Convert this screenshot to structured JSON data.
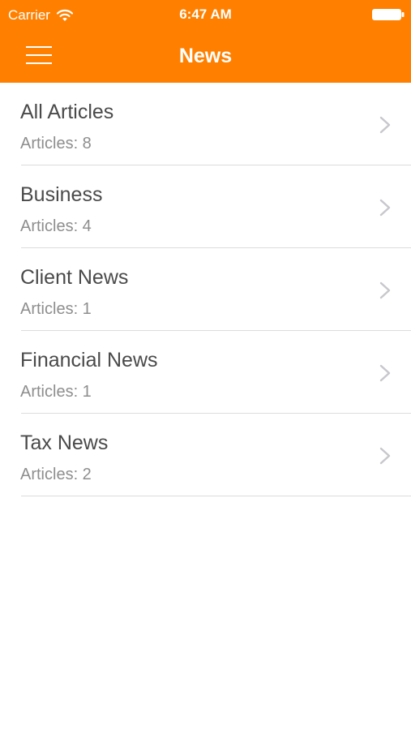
{
  "status_bar": {
    "carrier": "Carrier",
    "time": "6:47 AM",
    "wifi_icon": "wifi-icon",
    "battery_icon": "battery-full-icon"
  },
  "nav": {
    "title": "News",
    "menu_icon": "hamburger-menu-icon"
  },
  "colors": {
    "header_bg": "#ff8000",
    "header_text": "#ffffff",
    "row_title": "#4a4a4a",
    "row_subtitle": "#8e8e8e",
    "separator": "#dcdcdc",
    "chevron": "#c7c7cc"
  },
  "categories": [
    {
      "title": "All Articles",
      "count": "Articles: 8"
    },
    {
      "title": "Business",
      "count": "Articles: 4"
    },
    {
      "title": "Client News",
      "count": "Articles: 1"
    },
    {
      "title": "Financial News",
      "count": "Articles: 1"
    },
    {
      "title": "Tax News",
      "count": "Articles: 2"
    }
  ]
}
